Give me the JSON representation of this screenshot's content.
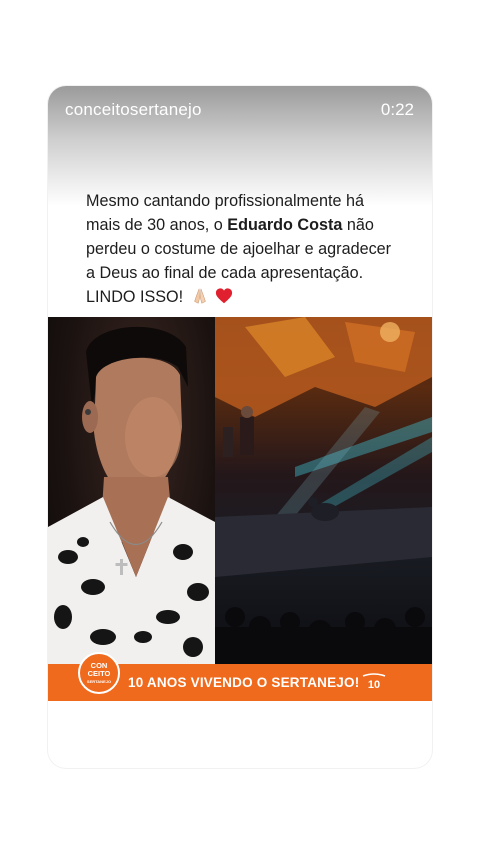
{
  "story": {
    "username": "conceitosertanejo",
    "timer": "0:22"
  },
  "caption": {
    "part1": "Mesmo cantando profissionalmente há mais de 30 anos, o ",
    "bold": "Eduardo Costa",
    "part2": " não perdeu o costume de ajoelhar e agradecer a Deus ao final de cada apresentação. LINDO ISSO!"
  },
  "banner": {
    "text": "10 ANOS VIVENDO O SERTANEJO!",
    "logo_text_1": "CON",
    "logo_text_2": "CEITO",
    "logo_text_3": "SERTANEJO",
    "badge": "10"
  },
  "colors": {
    "banner": "#ef6a1d",
    "text": "#1d1d1d"
  }
}
